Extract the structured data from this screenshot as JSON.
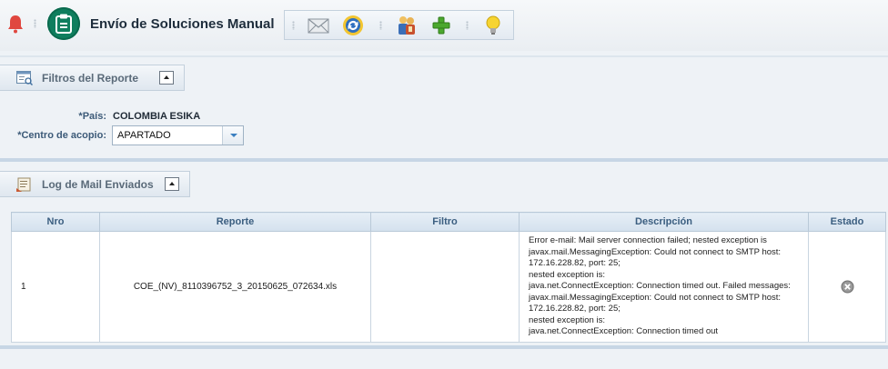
{
  "header": {
    "title": "Envío de Soluciones Manual",
    "icons": [
      "bell-icon",
      "clipboard-icon"
    ],
    "toolbar": [
      {
        "name": "mail-icon",
        "label": "Enviar correo"
      },
      {
        "name": "refresh-icon",
        "label": "Actualizar"
      },
      {
        "name": "users-icon",
        "label": "Usuarios"
      },
      {
        "name": "add-icon",
        "label": "Agregar"
      },
      {
        "name": "lightbulb-icon",
        "label": "Ayuda"
      }
    ]
  },
  "filters": {
    "section_title": "Filtros del Reporte",
    "pais_label": "*País:",
    "pais_value": "COLOMBIA ESIKA",
    "centro_label": "*Centro de acopio:",
    "centro_value": "APARTADO"
  },
  "log": {
    "section_title": "Log de Mail Enviados",
    "columns": [
      "Nro",
      "Reporte",
      "Filtro",
      "Descripción",
      "Estado"
    ],
    "rows": [
      {
        "nro": "1",
        "reporte": "COE_(NV)_8110396752_3_20150625_072634.xls",
        "filtro": "",
        "descripcion": [
          "Error e-mail: Mail server connection failed; nested exception is",
          "javax.mail.MessagingException: Could not connect to SMTP host:",
          "172.16.228.82, port: 25;",
          "nested exception is:",
          "java.net.ConnectException: Connection timed out. Failed messages:",
          "javax.mail.MessagingException: Could not connect to SMTP host:",
          "172.16.228.82, port: 25;",
          "nested exception is:",
          "java.net.ConnectException: Connection timed out"
        ],
        "estado_icon": "error-circle-icon"
      }
    ]
  },
  "colors": {
    "accent": "#0f7e5e",
    "header_text": "#3b5e80",
    "bell": "#e0473f"
  }
}
